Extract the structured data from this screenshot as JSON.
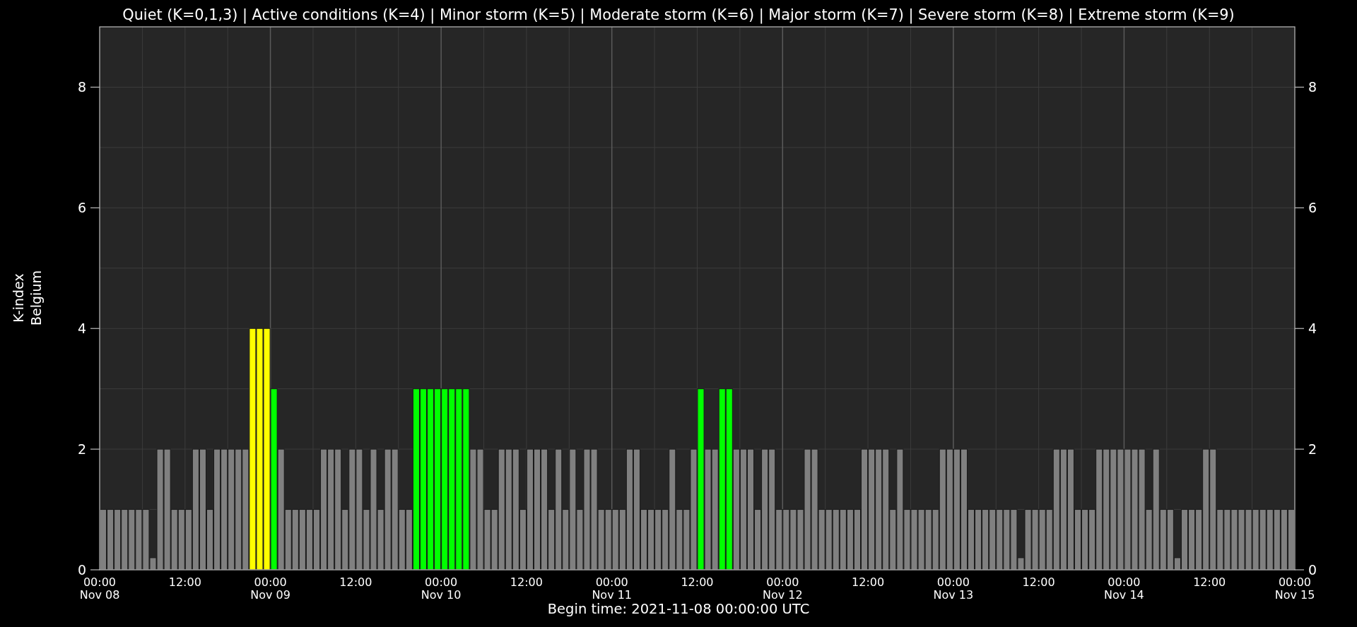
{
  "chart_data": {
    "type": "bar",
    "title": "Quiet (K=0,1,3) | Active conditions (K=4) | Minor storm (K=5) | Moderate storm (K=6) | Major storm (K=7) | Severe storm (K=8) | Extreme storm (K=9)",
    "xlabel": "Begin time: 2021-11-08 00:00:00 UTC",
    "ylabel": "K-index\nBelgium",
    "ylim": [
      0,
      9
    ],
    "yticks": [
      0,
      2,
      4,
      6,
      8
    ],
    "grid": true,
    "annotations": [
      "0",
      "2",
      "4",
      "6",
      "8",
      "00:00\nNov 15"
    ],
    "categories": [
      "00:00\nNov 08",
      null,
      null,
      null,
      null,
      null,
      null,
      null,
      null,
      null,
      null,
      null,
      "12:00",
      null,
      null,
      null,
      null,
      null,
      null,
      null,
      null,
      null,
      null,
      null,
      "00:00\nNov 09",
      null,
      null,
      null,
      null,
      null,
      null,
      null,
      null,
      null,
      null,
      null,
      "12:00",
      null,
      null,
      null,
      null,
      null,
      null,
      null,
      null,
      null,
      null,
      null,
      "00:00\nNov 10",
      null,
      null,
      null,
      null,
      null,
      null,
      null,
      null,
      null,
      null,
      null,
      "12:00",
      null,
      null,
      null,
      null,
      null,
      null,
      null,
      null,
      null,
      null,
      null,
      "00:00\nNov 11",
      null,
      null,
      null,
      null,
      null,
      null,
      null,
      null,
      null,
      null,
      null,
      "12:00",
      null,
      null,
      null,
      null,
      null,
      null,
      null,
      null,
      null,
      null,
      null,
      "00:00\nNov 12",
      null,
      null,
      null,
      null,
      null,
      null,
      null,
      null,
      null,
      null,
      null,
      "12:00",
      null,
      null,
      null,
      null,
      null,
      null,
      null,
      null,
      null,
      null,
      null,
      "00:00\nNov 13",
      null,
      null,
      null,
      null,
      null,
      null,
      null,
      null,
      null,
      null,
      null,
      "12:00",
      null,
      null,
      null,
      null,
      null,
      null,
      null,
      null,
      null,
      null,
      null,
      "00:00\nNov 14",
      null,
      null,
      null,
      null,
      null,
      null,
      null,
      null,
      null,
      null,
      null,
      "12:00",
      null,
      null,
      null,
      null,
      null,
      null,
      null,
      null,
      null,
      null,
      null
    ],
    "series": [
      {
        "color": "#808080",
        "values": [
          1,
          1,
          1,
          1,
          1,
          1,
          1,
          0.2,
          2,
          2,
          1,
          1,
          1,
          2,
          2,
          1,
          2,
          2,
          2,
          2,
          2,
          null,
          null,
          null,
          null,
          2,
          1,
          1,
          1,
          1,
          1,
          2,
          2,
          2,
          1,
          2,
          2,
          1,
          2,
          1,
          2,
          2,
          1,
          1,
          null,
          null,
          null,
          null,
          null,
          null,
          null,
          null,
          2,
          2,
          1,
          1,
          2,
          2,
          2,
          1,
          2,
          2,
          2,
          1,
          2,
          1,
          2,
          1,
          2,
          2,
          1,
          1,
          1,
          1,
          2,
          2,
          1,
          1,
          1,
          1,
          2,
          1,
          1,
          2,
          null,
          2,
          2,
          null,
          null,
          2,
          2,
          2,
          1,
          2,
          2,
          1,
          1,
          1,
          1,
          2,
          2,
          1,
          1,
          1,
          1,
          1,
          1,
          2,
          2,
          2,
          2,
          1,
          2,
          1,
          1,
          1,
          1,
          1,
          2,
          2,
          2,
          2,
          1,
          1,
          1,
          1,
          1,
          1,
          1,
          0.2,
          1,
          1,
          1,
          1,
          2,
          2,
          2,
          1,
          1,
          1,
          2,
          2,
          2,
          2,
          2,
          2,
          2,
          1,
          2,
          1,
          1,
          0.2,
          1,
          1,
          1,
          2,
          2,
          1,
          1,
          1,
          1,
          1,
          1,
          1,
          1,
          1,
          1,
          1
        ]
      },
      {
        "color": "#00ff00",
        "values": [
          null,
          null,
          null,
          null,
          null,
          null,
          null,
          null,
          null,
          null,
          null,
          null,
          null,
          null,
          null,
          null,
          null,
          null,
          null,
          null,
          null,
          null,
          null,
          null,
          3,
          null,
          null,
          null,
          null,
          null,
          null,
          null,
          null,
          null,
          null,
          null,
          null,
          null,
          null,
          null,
          null,
          null,
          null,
          null,
          3,
          3,
          3,
          3,
          3,
          3,
          3,
          3,
          null,
          null,
          null,
          null,
          null,
          null,
          null,
          null,
          null,
          null,
          null,
          null,
          null,
          null,
          null,
          null,
          null,
          null,
          null,
          null,
          null,
          null,
          null,
          null,
          null,
          null,
          null,
          null,
          null,
          null,
          null,
          null,
          3,
          null,
          null,
          3,
          3,
          null,
          null,
          null,
          null,
          null,
          null,
          null,
          null,
          null,
          null,
          null,
          null,
          null,
          null,
          null,
          null,
          null,
          null,
          null,
          null,
          null,
          null,
          null,
          null,
          null,
          null,
          null,
          null,
          null,
          null,
          null,
          null,
          null,
          null,
          null,
          null,
          null,
          null,
          null,
          null,
          null,
          null,
          null,
          null,
          null,
          null,
          null,
          null,
          null,
          null,
          null,
          null,
          null,
          null,
          null,
          null,
          null,
          null,
          null,
          null,
          null,
          null,
          null,
          null,
          null,
          null,
          null,
          null,
          null,
          null,
          null,
          null,
          null,
          null,
          null,
          null,
          null,
          null,
          null
        ]
      },
      {
        "color": "#ffff00",
        "values": [
          null,
          null,
          null,
          null,
          null,
          null,
          null,
          null,
          null,
          null,
          null,
          null,
          null,
          null,
          null,
          null,
          null,
          null,
          null,
          null,
          null,
          4,
          4,
          4,
          null,
          null,
          null,
          null,
          null,
          null,
          null,
          null,
          null,
          null,
          null,
          null,
          null,
          null,
          null,
          null,
          null,
          null,
          null,
          null,
          null,
          null,
          null,
          null,
          null,
          null,
          null,
          null,
          null,
          null,
          null,
          null,
          null,
          null,
          null,
          null,
          null,
          null,
          null,
          null,
          null,
          null,
          null,
          null,
          null,
          null,
          null,
          null,
          null,
          null,
          null,
          null,
          null,
          null,
          null,
          null,
          null,
          null,
          null,
          null,
          null,
          null,
          null,
          null,
          null,
          null,
          null,
          null,
          null,
          null,
          null,
          null,
          null,
          null,
          null,
          null,
          null,
          null,
          null,
          null,
          null,
          null,
          null,
          null,
          null,
          null,
          null,
          null,
          null,
          null,
          null,
          null,
          null,
          null,
          null,
          null,
          null,
          null,
          null,
          null,
          null,
          null,
          null,
          null,
          null,
          null,
          null,
          null,
          null,
          null,
          null,
          null,
          null,
          null,
          null,
          null,
          null,
          null,
          null,
          null,
          null,
          null,
          null,
          null,
          null,
          null,
          null,
          null,
          null,
          null,
          null,
          null,
          null,
          null,
          null,
          null,
          null,
          null,
          null,
          null,
          null,
          null,
          null,
          null
        ]
      }
    ]
  }
}
